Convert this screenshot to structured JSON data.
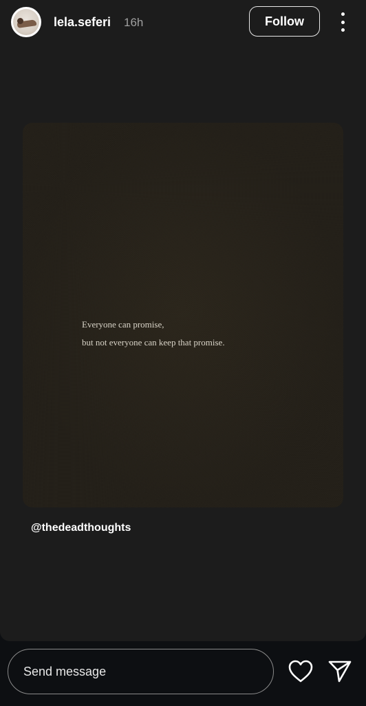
{
  "header": {
    "username": "lela.seferi",
    "timestamp": "16h",
    "follow_label": "Follow",
    "avatar_icon": "user-avatar",
    "more_icon": "more-vertical-icon"
  },
  "post": {
    "quote_line1": "Everyone can promise,",
    "quote_line2": "but not everyone can keep that promise.",
    "credit": "@thedeadthoughts"
  },
  "footer": {
    "message_placeholder": "Send message",
    "like_icon": "heart-icon",
    "share_icon": "send-icon"
  },
  "colors": {
    "story_background": "#1c1c1c",
    "card_background": "#231f18",
    "footer_background": "#0d0f12",
    "text": "#ffffff",
    "muted_text": "#a0a0a0"
  }
}
